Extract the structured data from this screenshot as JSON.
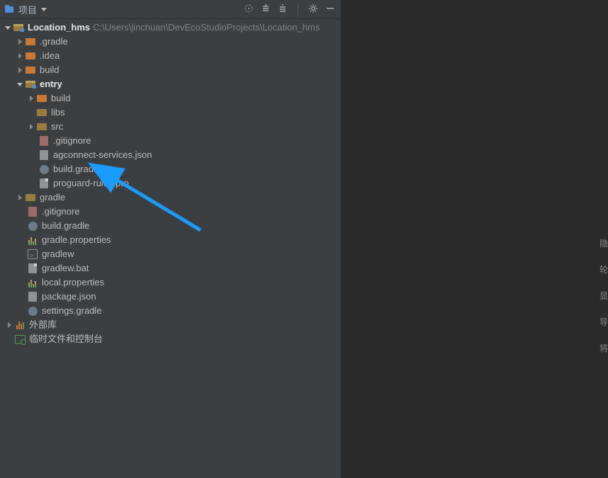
{
  "header": {
    "title": "项目"
  },
  "tree": {
    "root": {
      "name": "Location_hms",
      "path": "C:\\Users\\jinchuan\\DevEcoStudioProjects\\Location_hms"
    },
    "gradleDir": ".gradle",
    "idea": ".idea",
    "build": "build",
    "entry": "entry",
    "entry_build": "build",
    "entry_libs": "libs",
    "entry_src": "src",
    "entry_gitignore": ".gitignore",
    "entry_agc": "agconnect-services.json",
    "entry_bg": "build.gradle",
    "entry_pg": "proguard-rules.pro",
    "gradleDir2": "gradle",
    "gitignore": ".gitignore",
    "bg": "build.gradle",
    "gp": "gradle.properties",
    "gw": "gradlew",
    "gwbat": "gradlew.bat",
    "lp": "local.properties",
    "pkg": "package.json",
    "sg": "settings.gradle",
    "extlib": "外部库",
    "scratch": "临时文件和控制台"
  },
  "gutter": {
    "c1": "隐",
    "c2": "轮",
    "c3": "显",
    "c4": "导",
    "c5": "将"
  }
}
